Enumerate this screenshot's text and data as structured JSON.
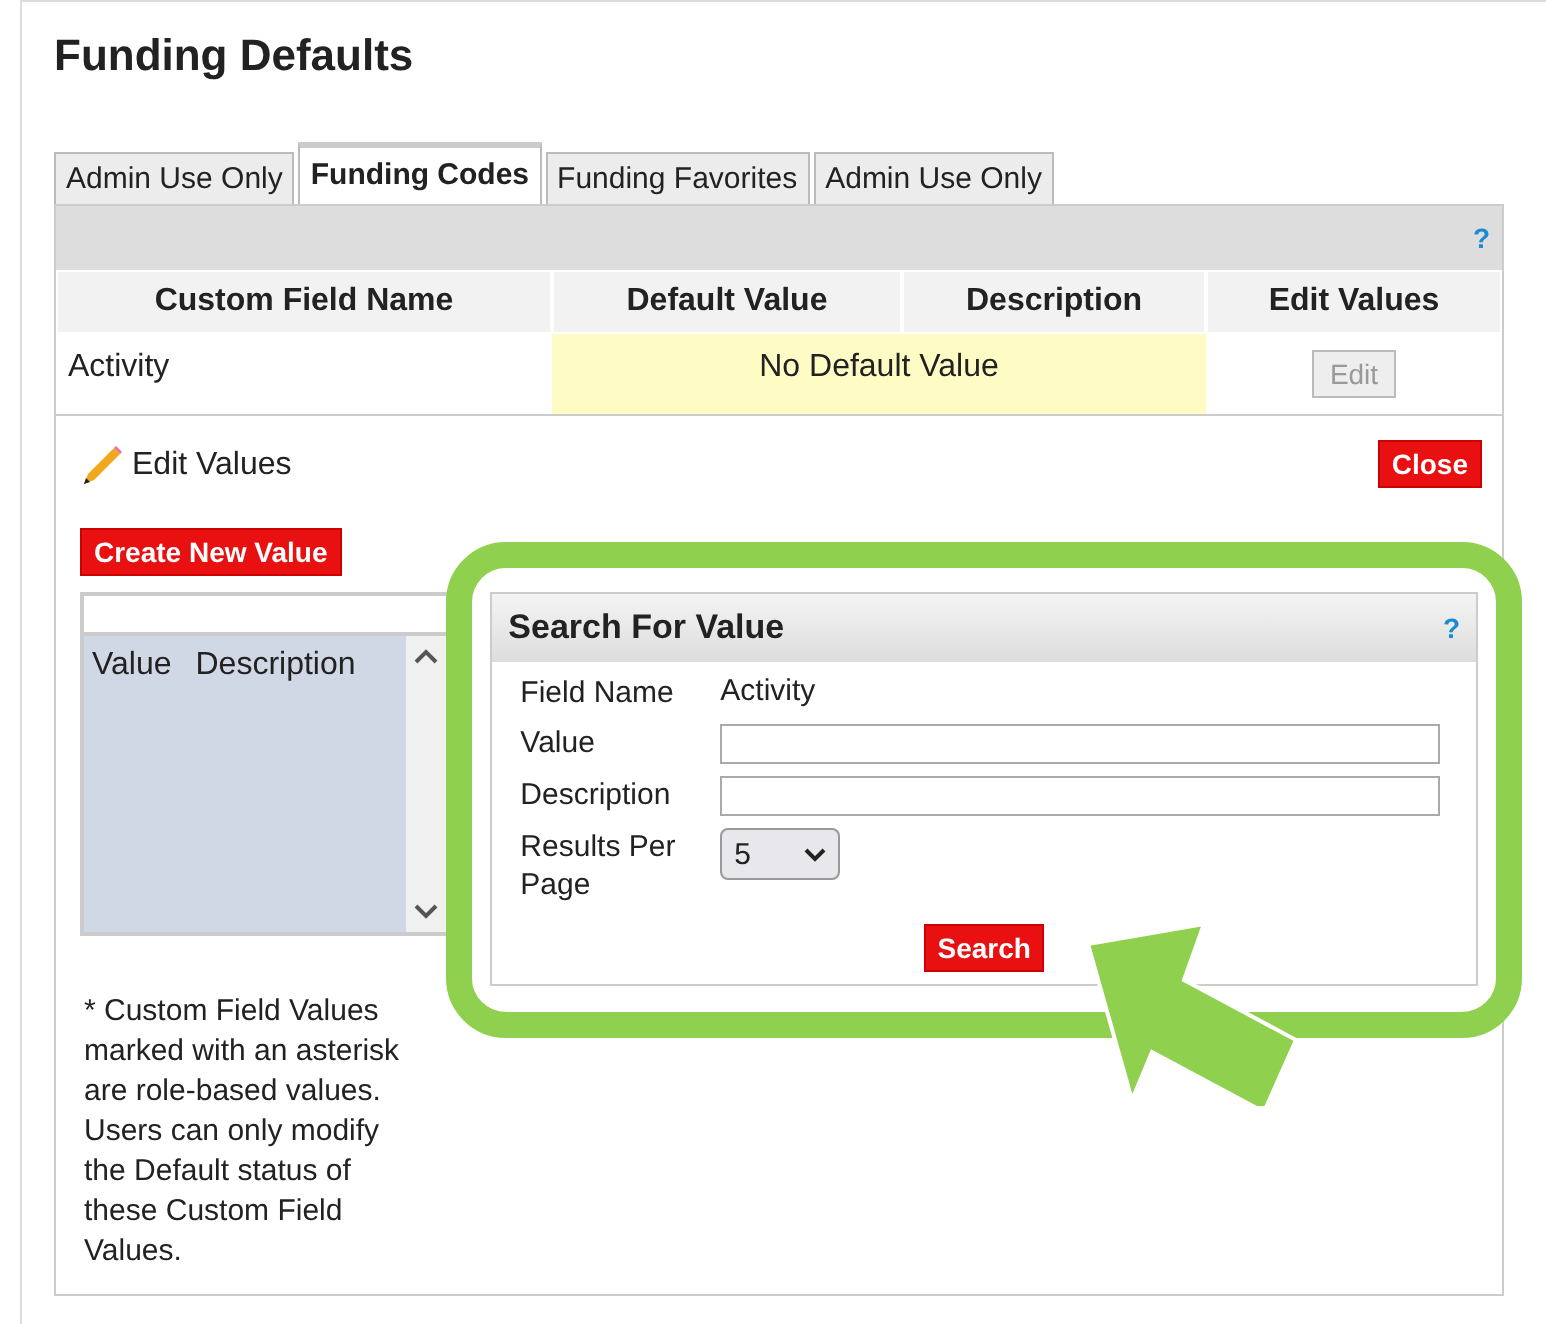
{
  "page": {
    "title": "Funding Defaults"
  },
  "tabs": [
    {
      "label": "Admin Use Only",
      "selected": false
    },
    {
      "label": "Funding Codes",
      "selected": true
    },
    {
      "label": "Funding Favorites",
      "selected": false
    },
    {
      "label": "Admin Use Only",
      "selected": false
    }
  ],
  "help": "?",
  "table": {
    "columns": [
      "Custom Field Name",
      "Default Value",
      "Description",
      "Edit Values"
    ],
    "rows": [
      {
        "name": "Activity",
        "default_value": "No Default Value",
        "edit_button": {
          "label": "Edit",
          "disabled": true
        }
      }
    ]
  },
  "edit_values": {
    "title": "Edit Values",
    "close": "Close",
    "create": "Create New Value",
    "list": {
      "columns": [
        "Value",
        "Description"
      ]
    },
    "note": "* Custom Field Values marked with an asterisk are role-based values. Users can only modify the Default status of these Custom Field Values."
  },
  "search": {
    "title": "Search For Value",
    "help": "?",
    "fields": [
      {
        "kind": "text",
        "label": "Field Name",
        "value": "Activity"
      },
      {
        "kind": "input",
        "label": "Value"
      },
      {
        "kind": "input",
        "label": "Description"
      },
      {
        "kind": "select",
        "label": "Results Per Page",
        "value": "5"
      }
    ],
    "button": "Search"
  }
}
